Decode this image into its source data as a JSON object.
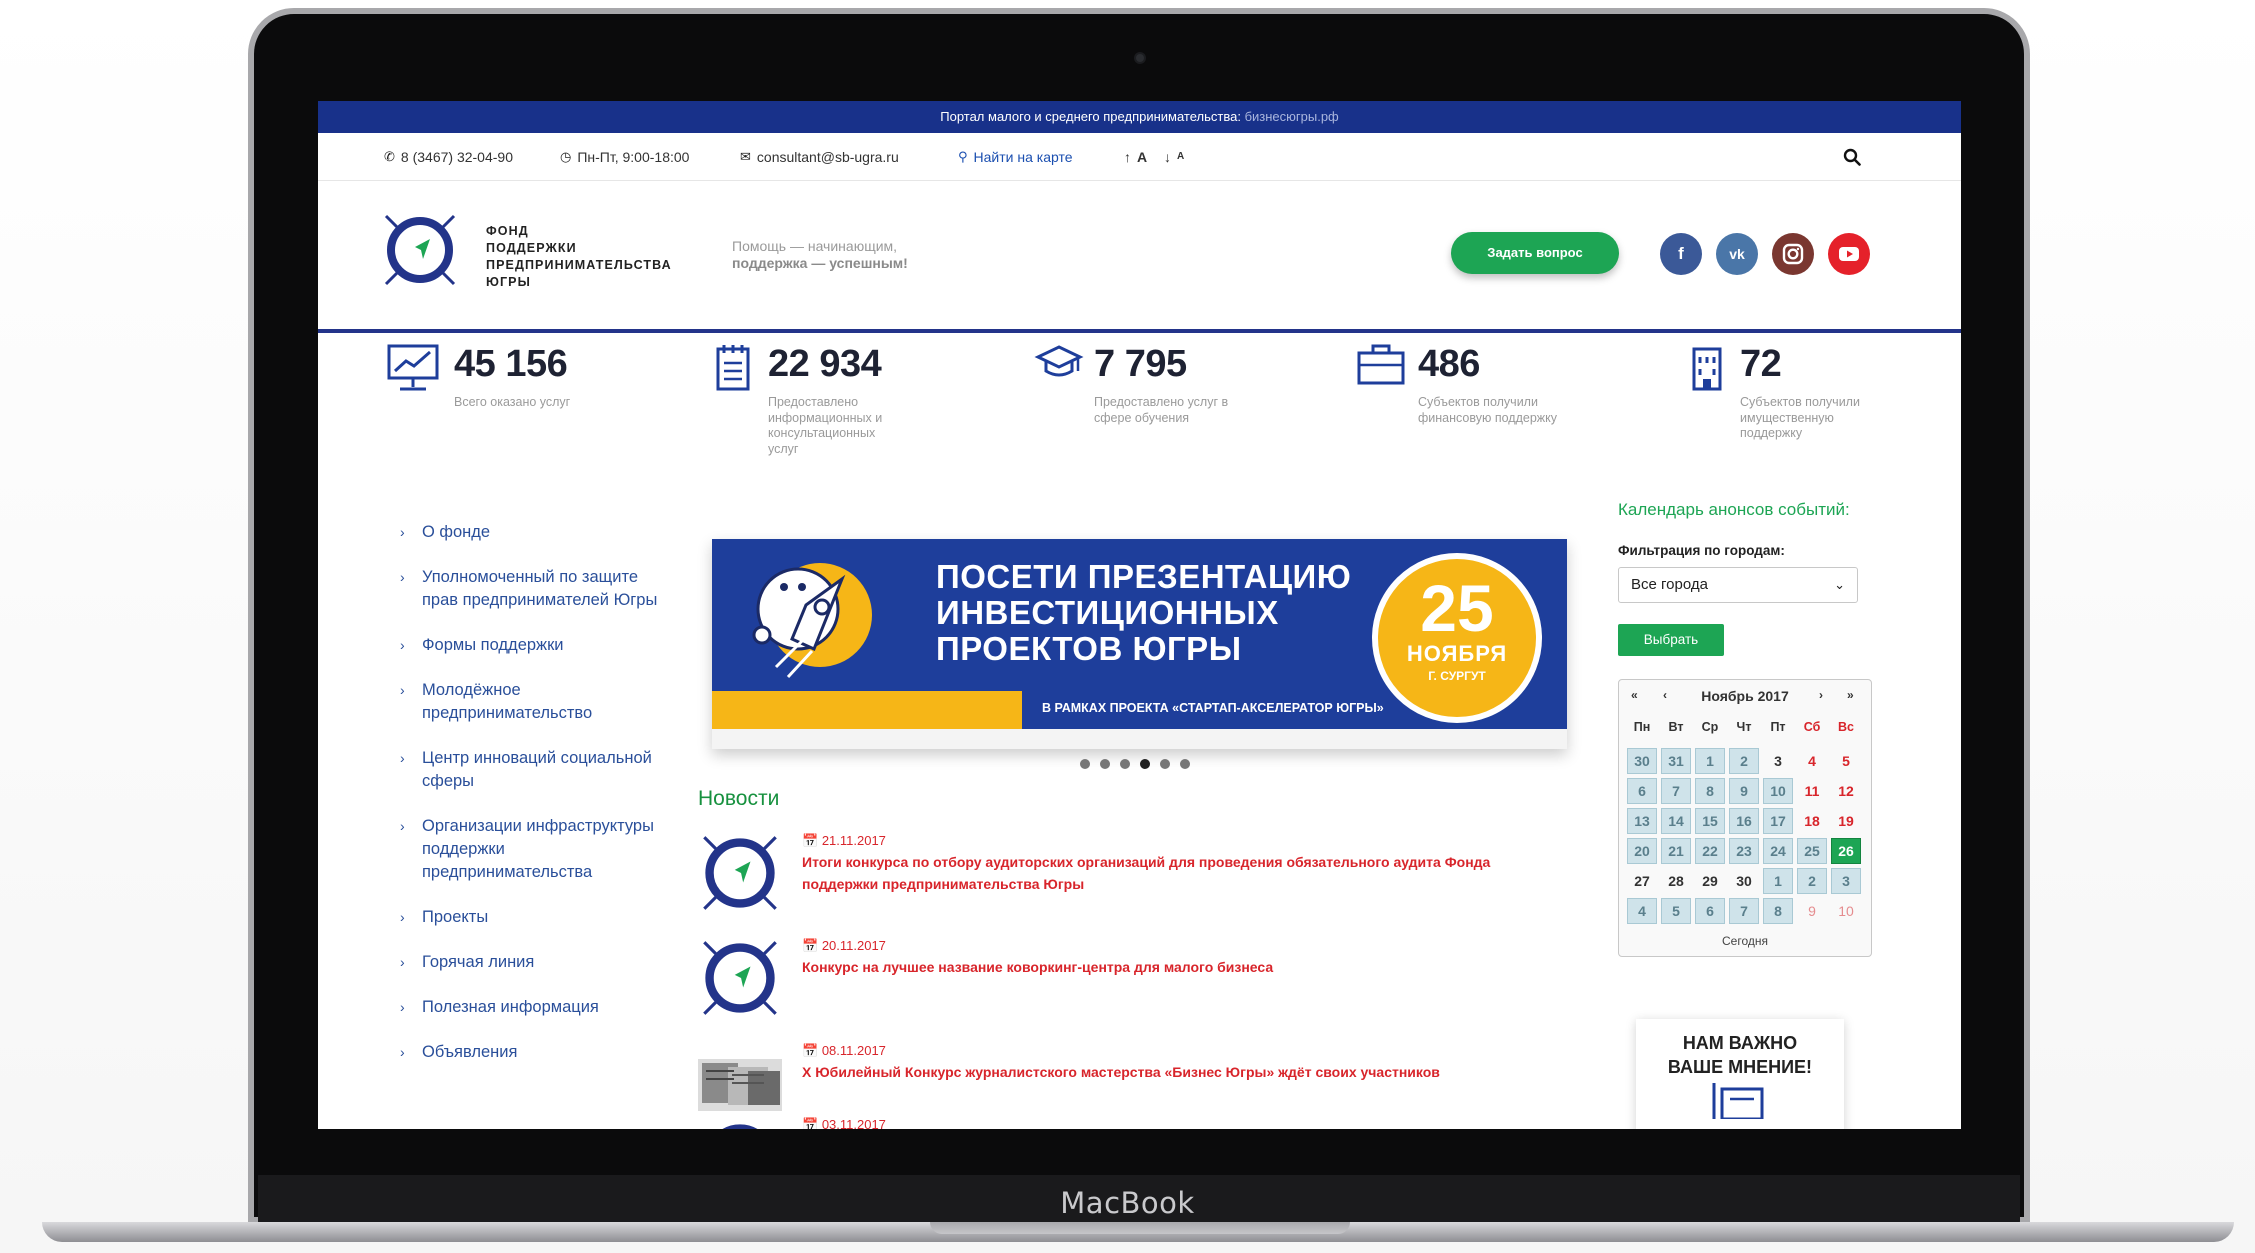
{
  "device": {
    "brand": "MacBook"
  },
  "topbar": {
    "text": "Портал малого и среднего предпринимательства: ",
    "domain": "бизнесюгры.рф"
  },
  "infobar": {
    "phone": "8 (3467) 32-04-90",
    "hours": "Пн-Пт, 9:00-18:00",
    "email": "consultant@sb-ugra.ru",
    "map_link": "Найти на карте",
    "font_up": "A",
    "font_down": "A"
  },
  "header": {
    "logo_text": [
      "Фонд",
      "поддержки",
      "предпринимательства",
      "Югры"
    ],
    "slogan_line1": "Помощь — начинающим,",
    "slogan_line2": "поддержка — успешным!",
    "ask_button": "Задать вопрос",
    "social": {
      "facebook": "f",
      "vk": "vk",
      "instagram": "ig",
      "youtube": "yt"
    },
    "colors": {
      "brand_blue": "#23348a",
      "green": "#1da554",
      "facebook": "#3b5998",
      "vk": "#4a76a8",
      "instagram": "#8a3a32",
      "youtube": "#e5212a"
    }
  },
  "stats": [
    {
      "icon": "presentation-chart-icon",
      "value": "45 156",
      "label": "Всего оказано услуг"
    },
    {
      "icon": "document-list-icon",
      "value": "22 934",
      "label": "Предоставлено информационных и консультационных услуг"
    },
    {
      "icon": "graduation-cap-icon",
      "value": "7 795",
      "label": "Предоставлено услуг в сфере обучения"
    },
    {
      "icon": "briefcase-icon",
      "value": "486",
      "label": "Субъектов получили финансовую поддержку"
    },
    {
      "icon": "building-icon",
      "value": "72",
      "label": "Субъектов получили имущественную поддержку"
    }
  ],
  "leftnav": [
    "О фонде",
    "Уполномоченный по защите прав предпринимателей Югры",
    "Формы поддержки",
    "Молодёжное предпринимательство",
    "Центр инноваций социальной сферы",
    "Организации инфраструктуры поддержки предпринимательства",
    "Проекты",
    "Горячая линия",
    "Полезная информация",
    "Объявления"
  ],
  "banner": {
    "title_lines": [
      "ПОСЕТИ ПРЕЗЕНТАЦИЮ",
      "ИНВЕСТИЦИОННЫХ",
      "ПРОЕКТОВ ЮГРЫ"
    ],
    "subtitle": "В РАМКАХ ПРОЕКТА «СТАРТАП-АКСЕЛЕРАТОР ЮГРЫ»",
    "day": "25",
    "month": "НОЯБРЯ",
    "city": "Г. СУРГУТ",
    "slides_count": 6,
    "active_slide": 4
  },
  "news": {
    "title": "Новости",
    "items": [
      {
        "date": "21.11.2017",
        "headline": "Итоги конкурса по отбору аудиторских организаций для проведения обязательного аудита Фонда поддержки предпринимательства Югры",
        "thumb": "logo"
      },
      {
        "date": "20.11.2017",
        "headline": "Конкурс на лучшее название коворкинг-центра для малого бизнеса",
        "thumb": "logo"
      },
      {
        "date": "08.11.2017",
        "headline": "X Юбилейный Конкурс журналистского мастерства «Бизнес Югры» ждёт своих участников",
        "thumb": "photo"
      },
      {
        "date": "03.11.2017",
        "headline": "",
        "thumb": "logo"
      }
    ]
  },
  "sidebar": {
    "calendar_title": "Календарь анонсов событий:",
    "filter_label": "Фильтрация по городам:",
    "city_value": "Все города",
    "choose_button": "Выбрать",
    "calendar": {
      "month_label": "Ноябрь 2017",
      "weekdays": [
        "Пн",
        "Вт",
        "Ср",
        "Чт",
        "Пт",
        "Сб",
        "Вс"
      ],
      "weeks": [
        [
          "30",
          "31",
          "1",
          "2",
          "3",
          "4",
          "5"
        ],
        [
          "6",
          "7",
          "8",
          "9",
          "10",
          "11",
          "12"
        ],
        [
          "13",
          "14",
          "15",
          "16",
          "17",
          "18",
          "19"
        ],
        [
          "20",
          "21",
          "22",
          "23",
          "24",
          "25",
          "26"
        ],
        [
          "27",
          "28",
          "29",
          "30",
          "1",
          "2",
          "3"
        ],
        [
          "4",
          "5",
          "6",
          "7",
          "8",
          "9",
          "10"
        ]
      ],
      "today_label": "Сегодня",
      "today_day": "26"
    },
    "opinion_lines": [
      "НАМ ВАЖНО",
      "ВАШЕ МНЕНИЕ!"
    ]
  }
}
